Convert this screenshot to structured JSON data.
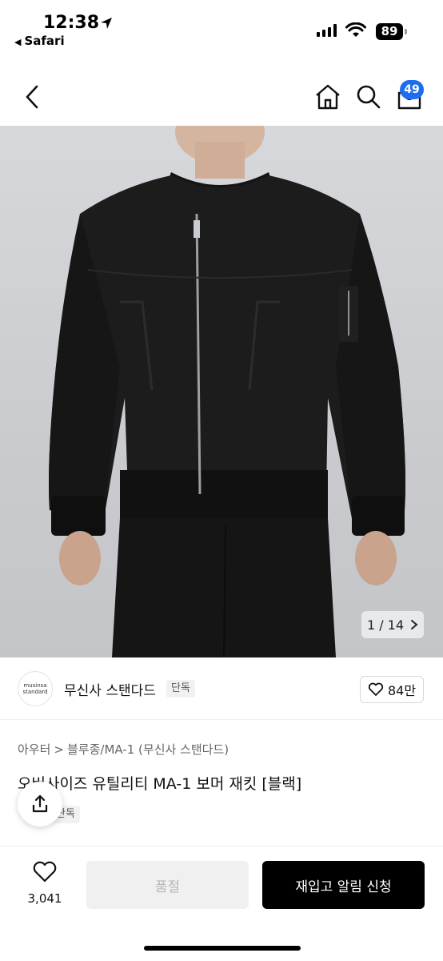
{
  "status": {
    "time": "12:38",
    "back_app": "Safari",
    "battery": "89"
  },
  "nav": {
    "cart_count": "49"
  },
  "gallery": {
    "current": "1",
    "total": "14",
    "indicator": "1 / 14"
  },
  "brand": {
    "logo_text_1": "musinsa",
    "logo_text_2": "standard",
    "name": "무신사 스탠다드",
    "badge": "단독",
    "likes": "84만"
  },
  "product": {
    "breadcrumb": [
      "아우터",
      "블루종/MA-1 (무신사 스탠다드)"
    ],
    "breadcrumb_sep": ">",
    "title": "오버사이즈 유틸리티 MA-1 보머 재킷 [블랙]",
    "exclusive_badge": "단독"
  },
  "bottom": {
    "wish_count": "3,041",
    "soldout_label": "품절",
    "restock_label": "재입고 알림 신청"
  },
  "colors": {
    "accent": "#1e6cf0",
    "primary_button": "#000000",
    "disabled_button": "#f0f0f0"
  }
}
